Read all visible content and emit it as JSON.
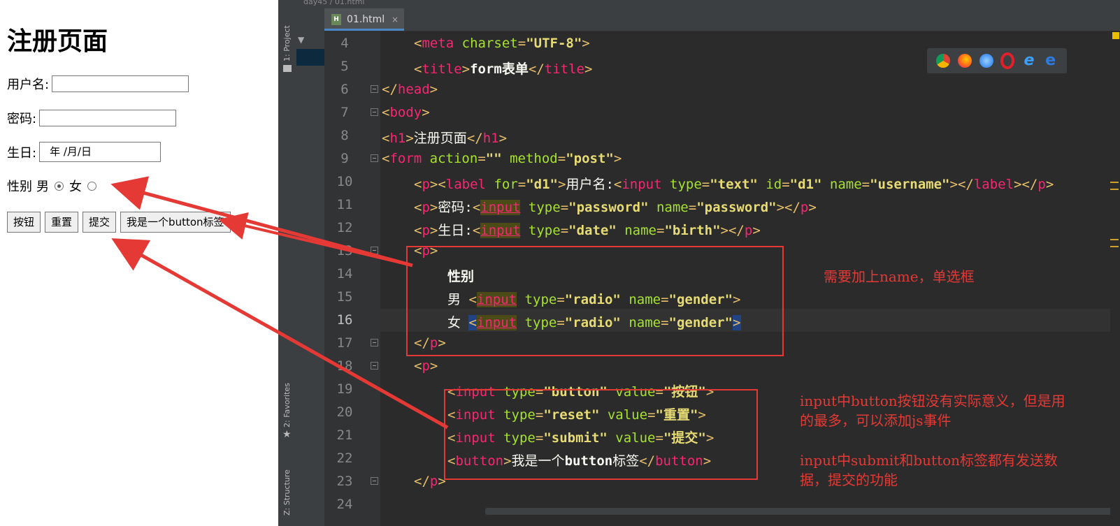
{
  "browser": {
    "heading": "注册页面",
    "username_label": "用户名:",
    "password_label": "密码:",
    "birth_label": "生日:",
    "birth_placeholder": "年 /月/日",
    "gender_label": "性别",
    "male_label": "男",
    "female_label": "女",
    "buttons": [
      "按钮",
      "重置",
      "提交",
      "我是一个button标签"
    ]
  },
  "ide": {
    "breadcrumb": "day45 / 01.html",
    "tab_label": "01.html",
    "tab_icon_text": "H",
    "side_labels": [
      "1: Project",
      "2: Favorites",
      "Z: Structure"
    ],
    "line_numbers": [
      "4",
      "5",
      "6",
      "7",
      "8",
      "9",
      "10",
      "11",
      "12",
      "13",
      "14",
      "15",
      "16",
      "17",
      "18",
      "19",
      "20",
      "21",
      "22",
      "23",
      "24"
    ],
    "current_line": "16",
    "browser_icons": [
      "chrome-icon",
      "firefox-icon",
      "safari-icon",
      "opera-icon",
      "ie-icon",
      "edge-icon"
    ]
  },
  "annotations": {
    "radio_note": "需要加上name，单选框",
    "button_note": "input中button按钮没有实际意义，但是用\n的最多，可以添加js事件",
    "submit_note": "input中submit和button标签都有发送数\n据，提交的功能"
  },
  "colors": {
    "annotation_red": "#e53935",
    "editor_bg": "#2b2b2b",
    "tag_pink": "#f92672",
    "attr_green": "#a6e22e",
    "string_yellow": "#e6db74"
  }
}
